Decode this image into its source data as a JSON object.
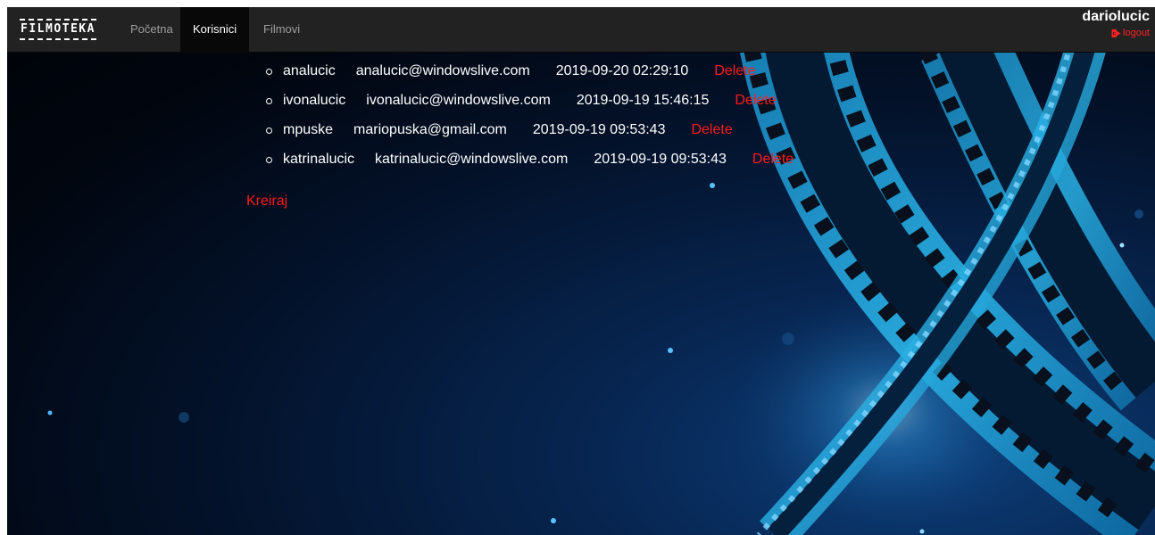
{
  "navbar": {
    "brand": "FILMOTEKA",
    "links": [
      {
        "label": "Početna",
        "active": false
      },
      {
        "label": "Korisnici",
        "active": true
      },
      {
        "label": "Filmovi",
        "active": false
      }
    ],
    "username": "dariolucic",
    "logout_label": "logout",
    "logout_icon": "sign-out-icon"
  },
  "users": [
    {
      "username": "analucic",
      "email": "analucic@windowslive.com",
      "created": "2019-09-20 02:29:10",
      "action": "Delete"
    },
    {
      "username": "ivonalucic",
      "email": "ivonalucic@windowslive.com",
      "created": "2019-09-19 15:46:15",
      "action": "Delete"
    },
    {
      "username": "mpuske",
      "email": "mariopuska@gmail.com",
      "created": "2019-09-19 09:53:43",
      "action": "Delete"
    },
    {
      "username": "katrinalucic",
      "email": "katrinalucic@windowslive.com",
      "created": "2019-09-19 09:53:43",
      "action": "Delete"
    }
  ],
  "create_label": "Kreiraj",
  "colors": {
    "navbar": "#222222",
    "nav_active": "#080808",
    "accent_red": "#ff1a1a",
    "film_blue": "#1f9fd6"
  }
}
